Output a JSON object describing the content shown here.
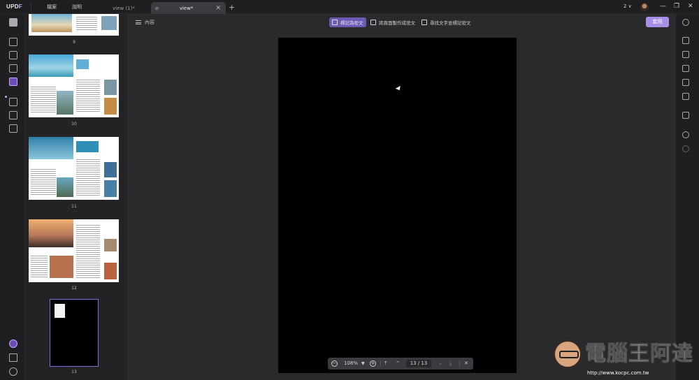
{
  "app": {
    "logo_main": "UPD",
    "logo_accent": "F"
  },
  "menu": {
    "file": "檔案",
    "help": "說明"
  },
  "tabs": [
    {
      "label": "view (1)*"
    },
    {
      "label": "view*"
    }
  ],
  "titlebar_right": {
    "window_count": "2 ∨"
  },
  "toolbar": {
    "toc_label": "內容",
    "mode_buttons": [
      "標記為密文",
      "將頁面製作成密文",
      "尋找文字並標記密文"
    ],
    "apply_label": "套用"
  },
  "thumbnails": {
    "page_numbers": [
      "9",
      "10",
      "11",
      "12",
      "13"
    ]
  },
  "zoom": {
    "level": "108%",
    "page_indicator": "13 / 13"
  },
  "watermark": {
    "text": "電腦王阿達",
    "url": "http://www.kocpc.com.tw"
  },
  "colors": {
    "accent": "#a98ee8",
    "selected_mode": "#6c59b3",
    "thumb_border": "#8b66d9"
  }
}
